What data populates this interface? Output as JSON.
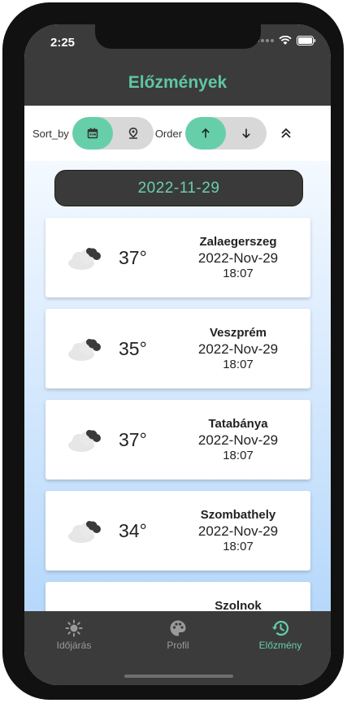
{
  "status": {
    "time": "2:25"
  },
  "header": {
    "title": "Előzmények"
  },
  "sortbar": {
    "sort_label": "Sort_by",
    "order_label": "Order"
  },
  "content": {
    "date": "2022-11-29",
    "cards": [
      {
        "temp": "37°",
        "city": "Zalaegerszeg",
        "date": "2022-Nov-29",
        "time": "18:07",
        "icon": "cloudy-icon"
      },
      {
        "temp": "35°",
        "city": "Veszprém",
        "date": "2022-Nov-29",
        "time": "18:07",
        "icon": "cloudy-icon"
      },
      {
        "temp": "37°",
        "city": "Tatabánya",
        "date": "2022-Nov-29",
        "time": "18:07",
        "icon": "cloudy-icon"
      },
      {
        "temp": "34°",
        "city": "Szombathely",
        "date": "2022-Nov-29",
        "time": "18:07",
        "icon": "cloudy-icon"
      },
      {
        "temp": "",
        "city": "Szolnok",
        "date": "",
        "time": "",
        "icon": "cloudy-icon"
      }
    ]
  },
  "nav": {
    "items": [
      {
        "label": "Időjárás",
        "icon": "sun-icon",
        "active": false
      },
      {
        "label": "Profil",
        "icon": "palette-icon",
        "active": false
      },
      {
        "label": "Előzmény",
        "icon": "history-icon",
        "active": true
      }
    ]
  },
  "colors": {
    "accent": "#66cfa9",
    "bar": "#3b3b3b",
    "inactive": "#9a9a9a"
  }
}
